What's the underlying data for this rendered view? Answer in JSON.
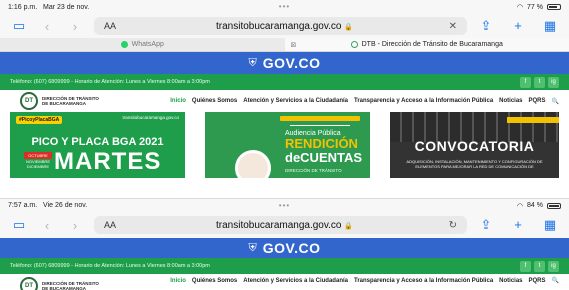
{
  "top": {
    "status": {
      "time": "1:16 p.m.",
      "date": "Mar 23 de nov.",
      "battery": "77 %",
      "battery_level": 0.77
    },
    "toolbar": {
      "aa": "AA",
      "url": "transitobucaramanga.gov.co",
      "lock": "🔒",
      "action": "✕"
    },
    "tabs": [
      {
        "label": "WhatsApp",
        "active": false
      },
      {
        "label": "DTB - Dirección de Tránsito de Bucaramanga",
        "active": true
      }
    ]
  },
  "bottom": {
    "status": {
      "time": "7:57 a.m.",
      "date": "Vie 26 de nov.",
      "battery": "84 %",
      "battery_level": 0.84
    },
    "toolbar": {
      "aa": "AA",
      "url": "transitobucaramanga.gov.co",
      "lock": "🔒",
      "action": "↻"
    }
  },
  "site": {
    "gov": "GOV.CO",
    "info": "Teléfono: (607) 6809999 - Horario de Atención: Lunes a Viernes 8:00am a 3:00pm",
    "logo_text": "DIRECCIÓN DE TRÁNSITO DE BUCARAMANGA",
    "logo_mark": "DT",
    "menu": [
      "Inicio",
      "Quiénes Somos",
      "Atención y Servicios a la Ciudadanía",
      "Transparencia y Acceso a la Información Pública",
      "Noticias",
      "PQRS"
    ],
    "social": [
      "f",
      "t",
      "ig"
    ]
  },
  "hero": {
    "p1": {
      "tag": "#PicoyPlacaBGA",
      "brand": "transitobucaramanga.gov.co",
      "title": "PICO Y PLACA BGA 2021",
      "badge": "OCTUBRE",
      "months": "NOVIEMBRE DICIEMBRE",
      "day": "MARTES"
    },
    "p2": {
      "aud": "Audiencia Pública",
      "rend1": "RENDICIÓN",
      "rend2": "deCUENTAS",
      "dir": "DIRECCIÓN DE TRÁNSITO"
    },
    "p3": {
      "title": "CONVOCATORIA",
      "desc": "ADQUISICIÓN, INSTALACIÓN, MANTENIMIENTO Y CONFIGURACIÓN DE ELEMENTOS PARA MEJORAR LA RED DE COMUNICACIÓN DE"
    }
  },
  "colors": {
    "gov_blue": "#3366cc",
    "site_green": "#1e9e4a",
    "accent_yellow": "#f2c200"
  }
}
